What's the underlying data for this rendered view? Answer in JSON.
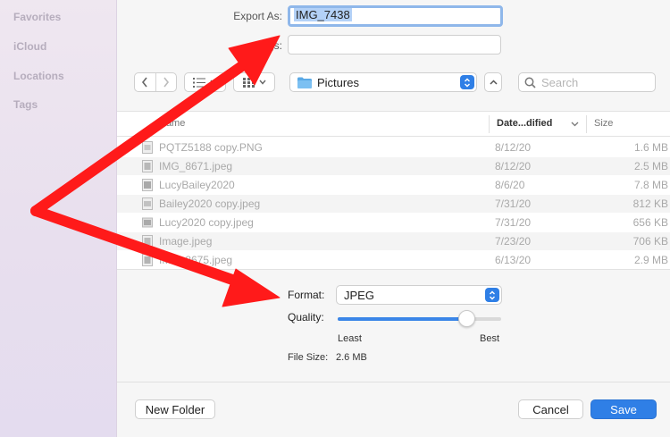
{
  "sidebar": {
    "items": [
      {
        "label": "Favorites"
      },
      {
        "label": "iCloud"
      },
      {
        "label": "Locations"
      },
      {
        "label": "Tags"
      }
    ]
  },
  "export": {
    "label": "Export As:",
    "filename": "IMG_7438",
    "tags_label": "Tags:",
    "tags_value": ""
  },
  "toolbar": {
    "back_icon": "chevron-left-icon",
    "forward_icon": "chevron-right-icon",
    "list_view_icon": "list-view-icon",
    "grid_view_icon": "grid-view-icon",
    "location": "Pictures",
    "folder_icon": "folder-icon",
    "expand_icon": "chevron-up-icon",
    "search_placeholder": "Search"
  },
  "table": {
    "columns": {
      "name": "Name",
      "date": "Date...dified",
      "size": "Size"
    },
    "rows": [
      {
        "name": "PQTZ5188 copy.PNG",
        "date": "8/12/20",
        "size": "1.6 MB"
      },
      {
        "name": "IMG_8671.jpeg",
        "date": "8/12/20",
        "size": "2.5 MB"
      },
      {
        "name": "LucyBailey2020",
        "date": "8/6/20",
        "size": "7.8 MB"
      },
      {
        "name": "Bailey2020 copy.jpeg",
        "date": "7/31/20",
        "size": "812 KB"
      },
      {
        "name": "Lucy2020 copy.jpeg",
        "date": "7/31/20",
        "size": "656 KB"
      },
      {
        "name": "Image.jpeg",
        "date": "7/23/20",
        "size": "706 KB"
      },
      {
        "name": "IMG_8675.jpeg",
        "date": "6/13/20",
        "size": "2.9 MB"
      }
    ]
  },
  "options": {
    "format_label": "Format:",
    "format_value": "JPEG",
    "quality_label": "Quality:",
    "quality_level": 0.79,
    "least_label": "Least",
    "best_label": "Best",
    "filesize_label": "File Size:",
    "filesize_value": "2.6 MB"
  },
  "footer": {
    "new_folder": "New Folder",
    "cancel": "Cancel",
    "save": "Save"
  },
  "colors": {
    "accent": "#2f7fe6",
    "annotation_arrow": "#ff1a1a",
    "sidebar_bg": "#ebe3ef"
  }
}
